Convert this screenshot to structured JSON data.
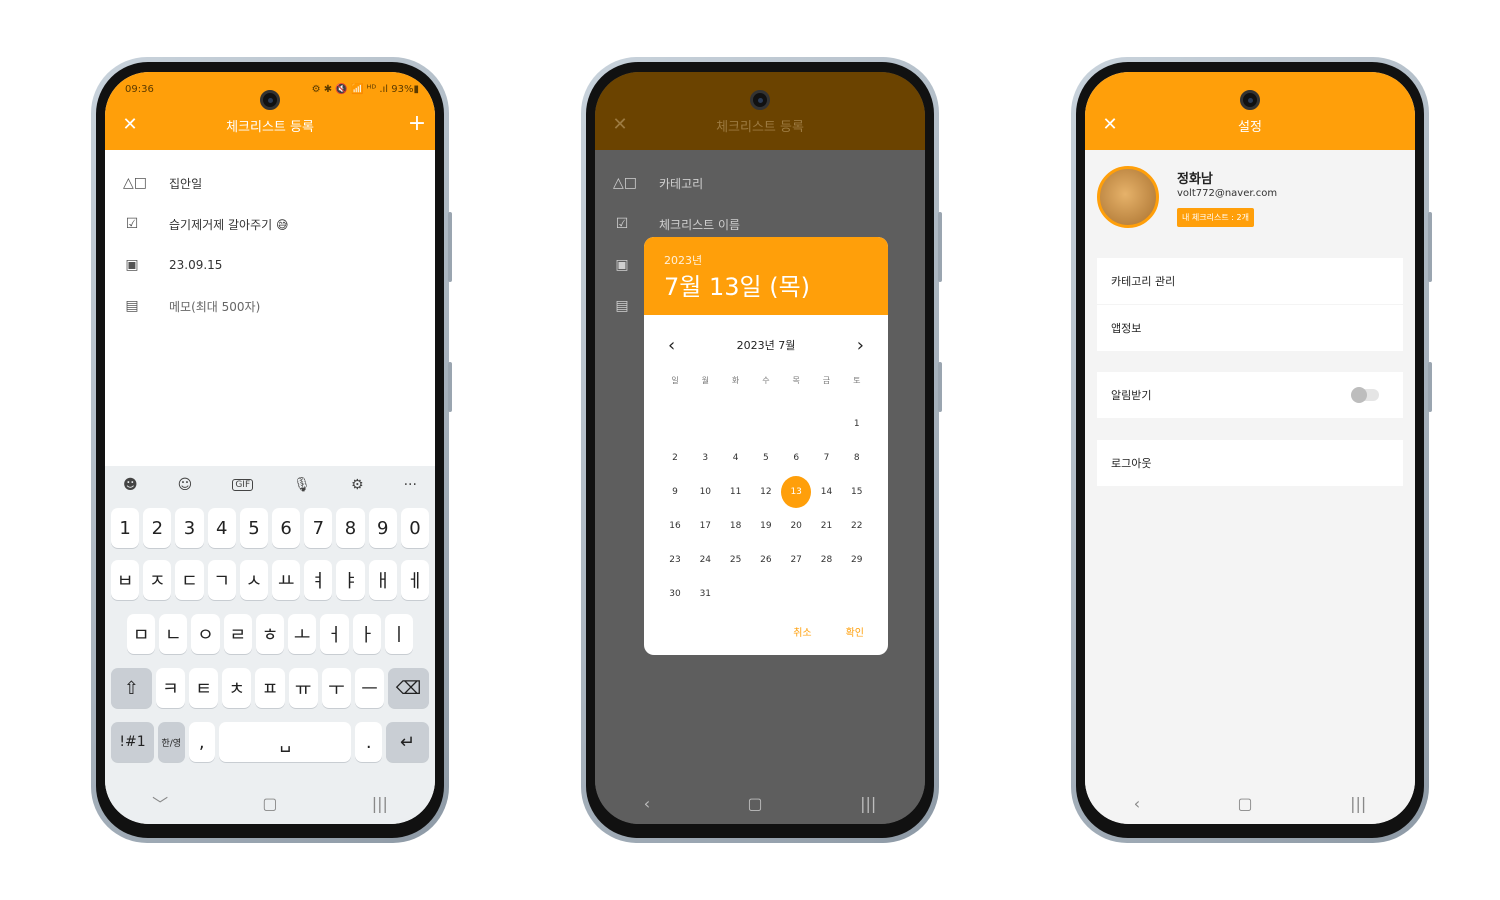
{
  "phone1": {
    "status": {
      "time": "09:36",
      "icons": "⚙ ✱ 🔇 📶 ᴴᴰ .ıl 93%▮"
    },
    "title": "체크리스트 등록",
    "rows": [
      {
        "icon": "shapes-icon",
        "glyph": "△□",
        "text": "집안일"
      },
      {
        "icon": "checklist-icon",
        "glyph": "☑",
        "text": "습기제거제 갈아주기 😅"
      },
      {
        "icon": "calendar-icon",
        "glyph": "▣",
        "text": "23.09.15"
      },
      {
        "icon": "memo-icon",
        "glyph": "▤",
        "text": "메모(최대 500자)"
      }
    ],
    "keyboard": {
      "tools": [
        "☻",
        "☺",
        "GIF",
        "🎙",
        "⚙",
        "···"
      ],
      "row1": [
        "1",
        "2",
        "3",
        "4",
        "5",
        "6",
        "7",
        "8",
        "9",
        "0"
      ],
      "row2": [
        "ㅂ",
        "ㅈ",
        "ㄷ",
        "ㄱ",
        "ㅅ",
        "ㅛ",
        "ㅕ",
        "ㅑ",
        "ㅐ",
        "ㅔ"
      ],
      "row3": [
        "ㅁ",
        "ㄴ",
        "ㅇ",
        "ㄹ",
        "ㅎ",
        "ㅗ",
        "ㅓ",
        "ㅏ",
        "ㅣ"
      ],
      "row4": [
        "⇧",
        "ㅋ",
        "ㅌ",
        "ㅊ",
        "ㅍ",
        "ㅠ",
        "ㅜ",
        "ㅡ",
        "⌫"
      ],
      "row5": [
        "!#1",
        "한/영",
        ",",
        "␣",
        ".",
        "↵"
      ]
    },
    "nav": [
      "﹀",
      "▢",
      "|||"
    ]
  },
  "phone2": {
    "title": "체크리스트 등록",
    "rows": [
      "카테고리",
      "체크리스트 이름"
    ],
    "dialog": {
      "year": "2023년",
      "date": "7월 13일 (목)",
      "month_label": "2023년 7월",
      "prev": "‹",
      "next": "›",
      "weekdays": [
        "일",
        "월",
        "화",
        "수",
        "목",
        "금",
        "토"
      ],
      "days": [
        "",
        "",
        "",
        "",
        "",
        "",
        "1",
        "2",
        "3",
        "4",
        "5",
        "6",
        "7",
        "8",
        "9",
        "10",
        "11",
        "12",
        "13",
        "14",
        "15",
        "16",
        "17",
        "18",
        "19",
        "20",
        "21",
        "22",
        "23",
        "24",
        "25",
        "26",
        "27",
        "28",
        "29",
        "30",
        "31"
      ],
      "selected": "13",
      "cancel": "취소",
      "ok": "확인"
    },
    "nav": [
      "‹",
      "▢",
      "|||"
    ]
  },
  "phone3": {
    "title": "설정",
    "profile": {
      "name": "정화남",
      "email": "volt772@naver.com",
      "badge": "내 체크리스트 : 2개"
    },
    "items": [
      "카테고리 관리",
      "앱정보",
      "알림받기",
      "로그아웃"
    ],
    "nav": [
      "‹",
      "▢",
      "|||"
    ]
  },
  "colors": {
    "accent": "#ff9f0a"
  }
}
